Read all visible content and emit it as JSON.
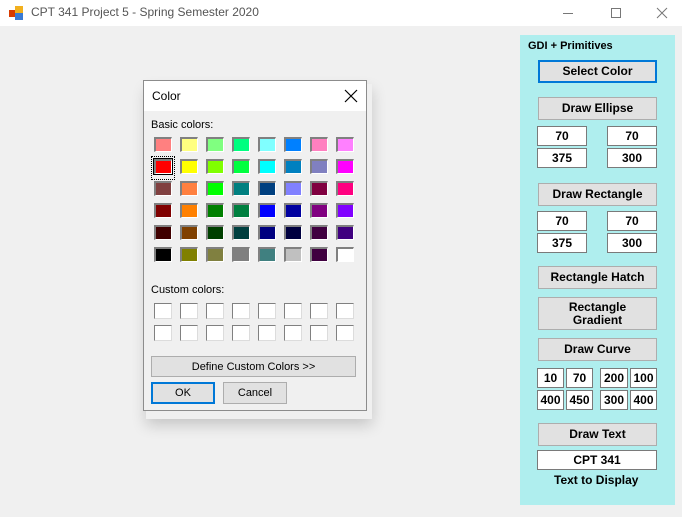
{
  "window": {
    "title": "CPT 341 Project 5 - Spring Semester 2020",
    "icons": {
      "app": "app-icon",
      "minimize": "minimize-icon",
      "maximize": "maximize-icon",
      "close": "close-icon"
    }
  },
  "panel": {
    "group_label": "GDI + Primitives",
    "select_color": "Select Color",
    "ellipse": {
      "button": "Draw Ellipse",
      "x": "70",
      "y": "70",
      "width": "375",
      "height": "300"
    },
    "rectangle": {
      "button": "Draw Rectangle",
      "x": "70",
      "y": "70",
      "width": "375",
      "height": "300"
    },
    "rectangle_hatch": "Rectangle Hatch",
    "rectangle_gradient": "Rectangle Gradient",
    "curve": {
      "button": "Draw Curve",
      "points": [
        "10",
        "70",
        "200",
        "100",
        "400",
        "450",
        "300",
        "400"
      ]
    },
    "text": {
      "button": "Draw Text",
      "value": "CPT 341",
      "caption": "Text to Display"
    },
    "background": "#afeeee"
  },
  "color_dialog": {
    "title": "Color",
    "basic_colors_label": "Basic colors:",
    "custom_colors_label": "Custom colors:",
    "define_custom": "Define Custom Colors >>",
    "ok": "OK",
    "cancel": "Cancel",
    "selected_index": 8,
    "basic_colors": [
      "#ff8080",
      "#ffff80",
      "#80ff80",
      "#00ff80",
      "#80ffff",
      "#0080ff",
      "#ff80c0",
      "#ff80ff",
      "#ff0000",
      "#ffff00",
      "#80ff00",
      "#00ff40",
      "#00ffff",
      "#0080c0",
      "#8080c0",
      "#ff00ff",
      "#804040",
      "#ff8040",
      "#00ff00",
      "#008080",
      "#004080",
      "#8080ff",
      "#800040",
      "#ff0080",
      "#800000",
      "#ff8000",
      "#008000",
      "#008040",
      "#0000ff",
      "#0000a0",
      "#800080",
      "#8000ff",
      "#400000",
      "#804000",
      "#004000",
      "#004040",
      "#000080",
      "#000040",
      "#400040",
      "#400080",
      "#000000",
      "#808000",
      "#808040",
      "#808080",
      "#408080",
      "#c0c0c0",
      "#400040",
      "#ffffff"
    ],
    "custom_colors": [
      "#ffffff",
      "#ffffff",
      "#ffffff",
      "#ffffff",
      "#ffffff",
      "#ffffff",
      "#ffffff",
      "#ffffff",
      "#ffffff",
      "#ffffff",
      "#ffffff",
      "#ffffff",
      "#ffffff",
      "#ffffff",
      "#ffffff",
      "#ffffff"
    ]
  }
}
